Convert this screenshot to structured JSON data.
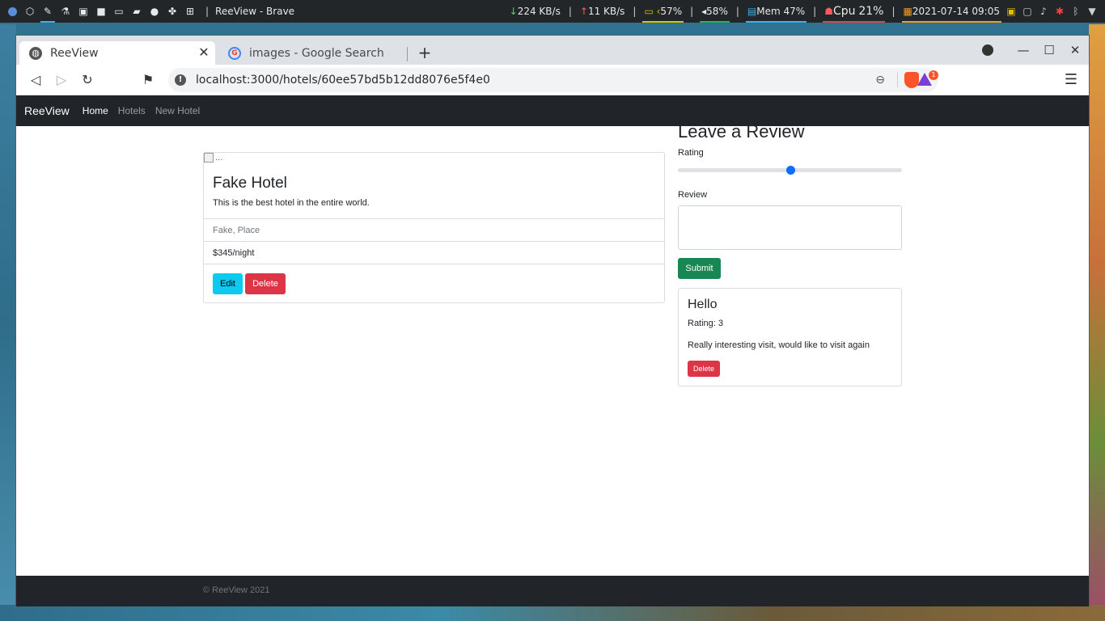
{
  "system_panel": {
    "window_title": "ReeView - Brave",
    "download": "224 KB/s",
    "upload": "11 KB/s",
    "battery": "57%",
    "volume": "58%",
    "mem": "Mem 47%",
    "cpu_label": "Cpu",
    "cpu": "21%",
    "datetime": "2021-07-14 09:05",
    "separator": "|"
  },
  "browser": {
    "tabs": [
      {
        "label": "ReeView"
      },
      {
        "label": "images - Google Search"
      }
    ],
    "url": "localhost:3000/hotels/60ee57bd5b12dd8076e5f4e0",
    "rewards_badge": "1"
  },
  "navbar": {
    "brand": "ReeView",
    "links": [
      "Home",
      "Hotels",
      "New Hotel"
    ]
  },
  "hotel": {
    "image_alt": "...",
    "title": "Fake Hotel",
    "description": "This is the best hotel in the entire world.",
    "location": "Fake, Place",
    "price": "$345/night",
    "edit_label": "Edit",
    "delete_label": "Delete"
  },
  "review_form": {
    "heading": "Leave a Review",
    "rating_label": "Rating",
    "rating_value": 0.5,
    "review_label": "Review",
    "review_value": "",
    "submit_label": "Submit"
  },
  "reviews": [
    {
      "title": "Hello",
      "rating": "Rating: 3",
      "body": "Really interesting visit, would like to visit again",
      "delete_label": "Delete"
    }
  ],
  "footer": {
    "text": "© ReeView 2021"
  },
  "colors": {
    "navbar_bg": "#212529",
    "edit_btn": "#0dcaf0",
    "delete_btn": "#dc3545",
    "submit_btn": "#198754",
    "range_thumb": "#0d6efd"
  }
}
